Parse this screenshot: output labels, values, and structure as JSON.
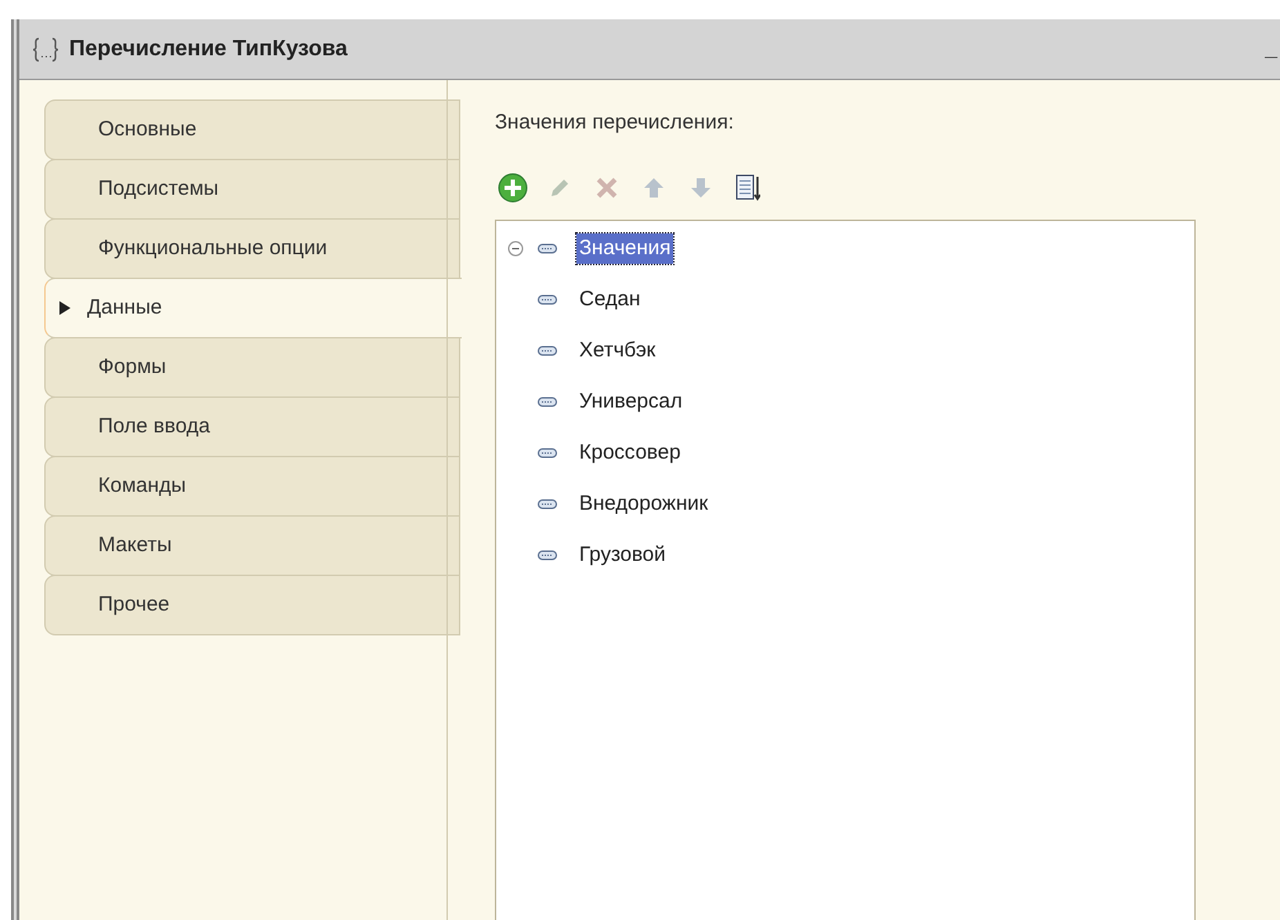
{
  "window": {
    "title": "Перечисление ТипКузова",
    "minimize": "_"
  },
  "tabs": [
    {
      "label": "Основные",
      "selected": false
    },
    {
      "label": "Подсистемы",
      "selected": false
    },
    {
      "label": "Функциональные опции",
      "selected": false
    },
    {
      "label": "Данные",
      "selected": true
    },
    {
      "label": "Формы",
      "selected": false
    },
    {
      "label": "Поле ввода",
      "selected": false
    },
    {
      "label": "Команды",
      "selected": false
    },
    {
      "label": "Макеты",
      "selected": false
    },
    {
      "label": "Прочее",
      "selected": false
    }
  ],
  "values_label": "Значения перечисления:",
  "toolbar": [
    {
      "kind": "add",
      "disabled": false
    },
    {
      "kind": "edit",
      "disabled": true
    },
    {
      "kind": "delete",
      "disabled": true
    },
    {
      "kind": "up",
      "disabled": true
    },
    {
      "kind": "down",
      "disabled": true
    },
    {
      "kind": "list",
      "disabled": false
    }
  ],
  "tree": [
    {
      "label": "Значения",
      "selected": true,
      "expanded": true,
      "children": [
        {
          "label": "Седан",
          "selected": false
        },
        {
          "label": "Хетчбэк",
          "selected": false
        },
        {
          "label": "Универсал",
          "selected": false
        },
        {
          "label": "Кроссовер",
          "selected": false
        },
        {
          "label": "Внедорожник",
          "selected": false
        },
        {
          "label": "Грузовой",
          "selected": false
        }
      ]
    }
  ]
}
